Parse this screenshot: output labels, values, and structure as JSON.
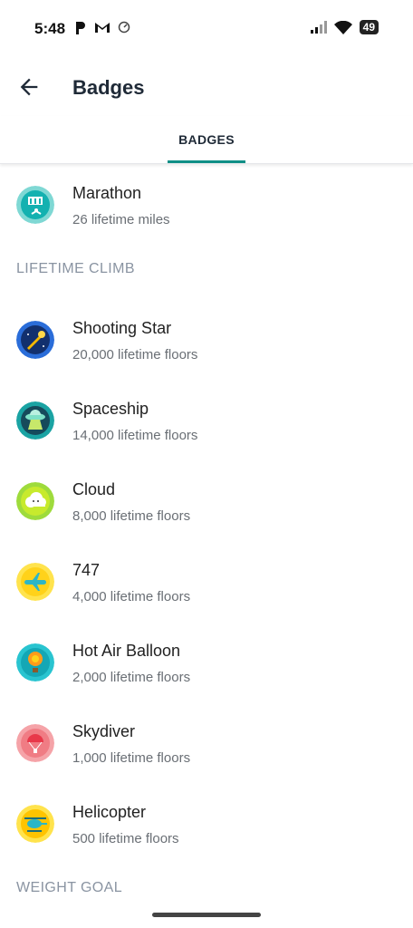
{
  "status_bar": {
    "time": "5:48",
    "battery": "49"
  },
  "app_bar": {
    "title": "Badges"
  },
  "tabs": [
    {
      "label": "BADGES"
    }
  ],
  "top_badge": {
    "name": "Marathon",
    "detail": "26 lifetime miles",
    "icon": "marathon-icon"
  },
  "sections": [
    {
      "label": "LIFETIME CLIMB",
      "badges": [
        {
          "name": "Shooting Star",
          "detail": "20,000 lifetime floors",
          "icon": "shooting-star-icon"
        },
        {
          "name": "Spaceship",
          "detail": "14,000 lifetime floors",
          "icon": "spaceship-icon"
        },
        {
          "name": "Cloud",
          "detail": "8,000 lifetime floors",
          "icon": "cloud-icon"
        },
        {
          "name": "747",
          "detail": "4,000 lifetime floors",
          "icon": "airplane-icon"
        },
        {
          "name": "Hot Air Balloon",
          "detail": "2,000 lifetime floors",
          "icon": "hot-air-balloon-icon"
        },
        {
          "name": "Skydiver",
          "detail": "1,000 lifetime floors",
          "icon": "skydiver-icon"
        },
        {
          "name": "Helicopter",
          "detail": "500 lifetime floors",
          "icon": "helicopter-icon"
        }
      ]
    },
    {
      "label": "WEIGHT GOAL",
      "badges": []
    }
  ],
  "colors": {
    "accent": "#0f8f86",
    "section_label": "#8a94a2"
  }
}
